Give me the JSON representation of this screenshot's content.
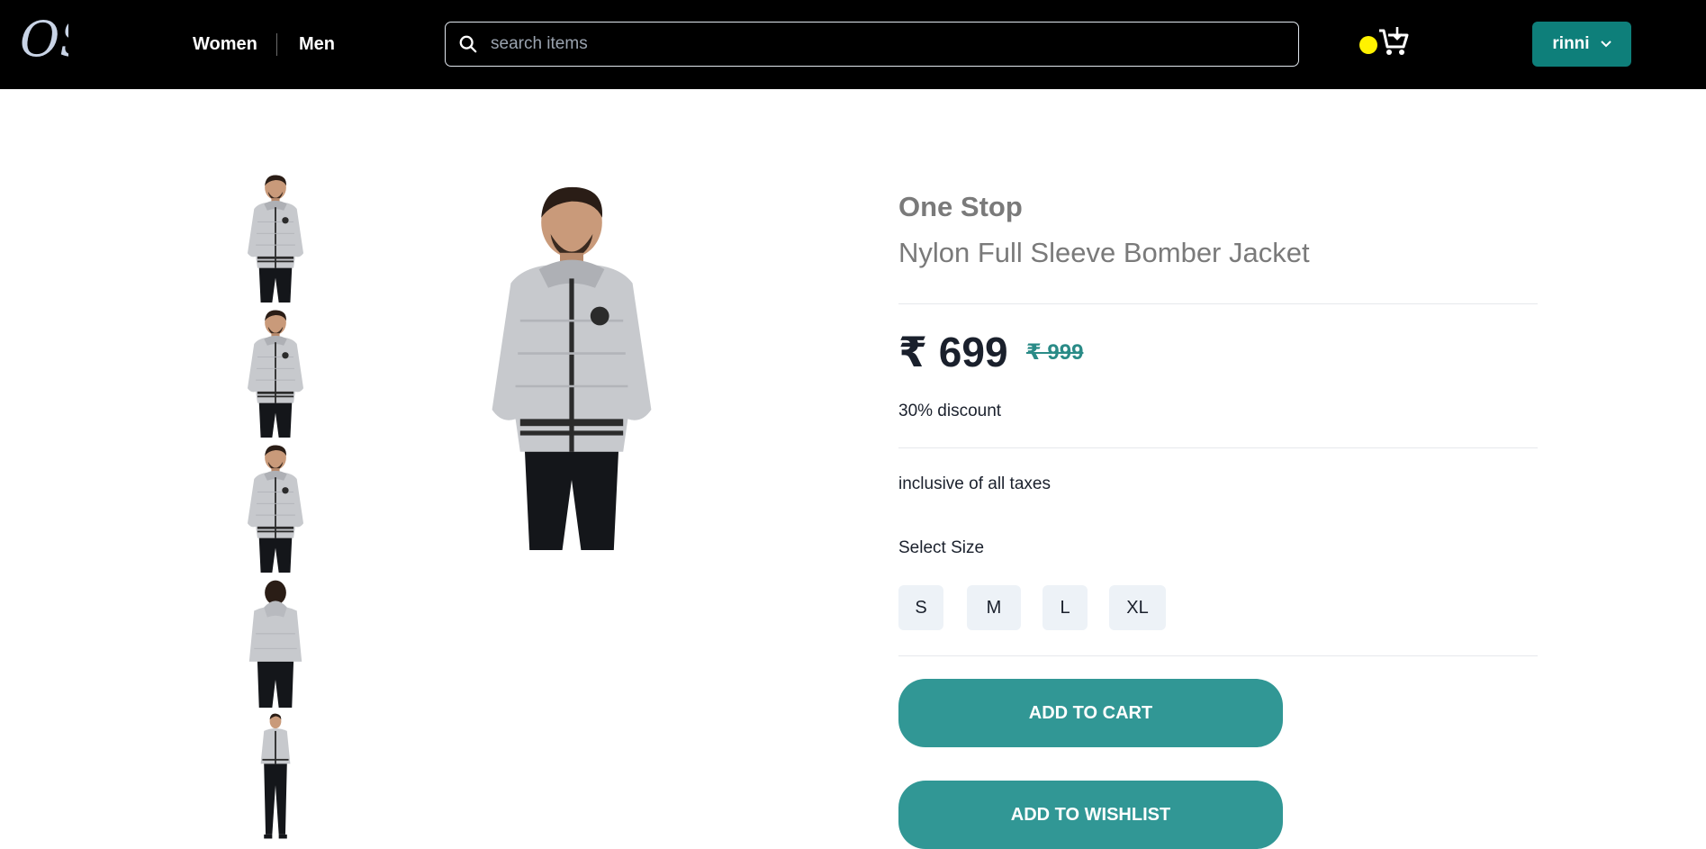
{
  "header": {
    "logo_text": "OS",
    "nav": {
      "women": "Women",
      "men": "Men"
    },
    "search": {
      "placeholder": "search items",
      "value": ""
    },
    "cart_icon": "cart-download-icon",
    "status_dot_color": "#fff200",
    "user": {
      "name": "rinni"
    }
  },
  "gallery": {
    "thumbnails": [
      "jacket-front",
      "jacket-side",
      "jacket-three-quarter",
      "jacket-back",
      "jacket-full-length"
    ],
    "main_image": "jacket-front"
  },
  "product": {
    "brand": "One Stop",
    "name": "Nylon Full Sleeve Bomber Jacket",
    "price": "₹ 699",
    "original_price": "₹ 999",
    "discount": "30% discount",
    "tax_note": "inclusive of all taxes",
    "size_label": "Select Size",
    "sizes": [
      "S",
      "M",
      "L",
      "XL"
    ],
    "add_to_cart": "ADD TO CART",
    "add_to_wishlist": "ADD TO WISHLIST"
  },
  "colors": {
    "accent": "#319795",
    "user_button": "#0e7f7a",
    "header_bg": "#000000"
  }
}
